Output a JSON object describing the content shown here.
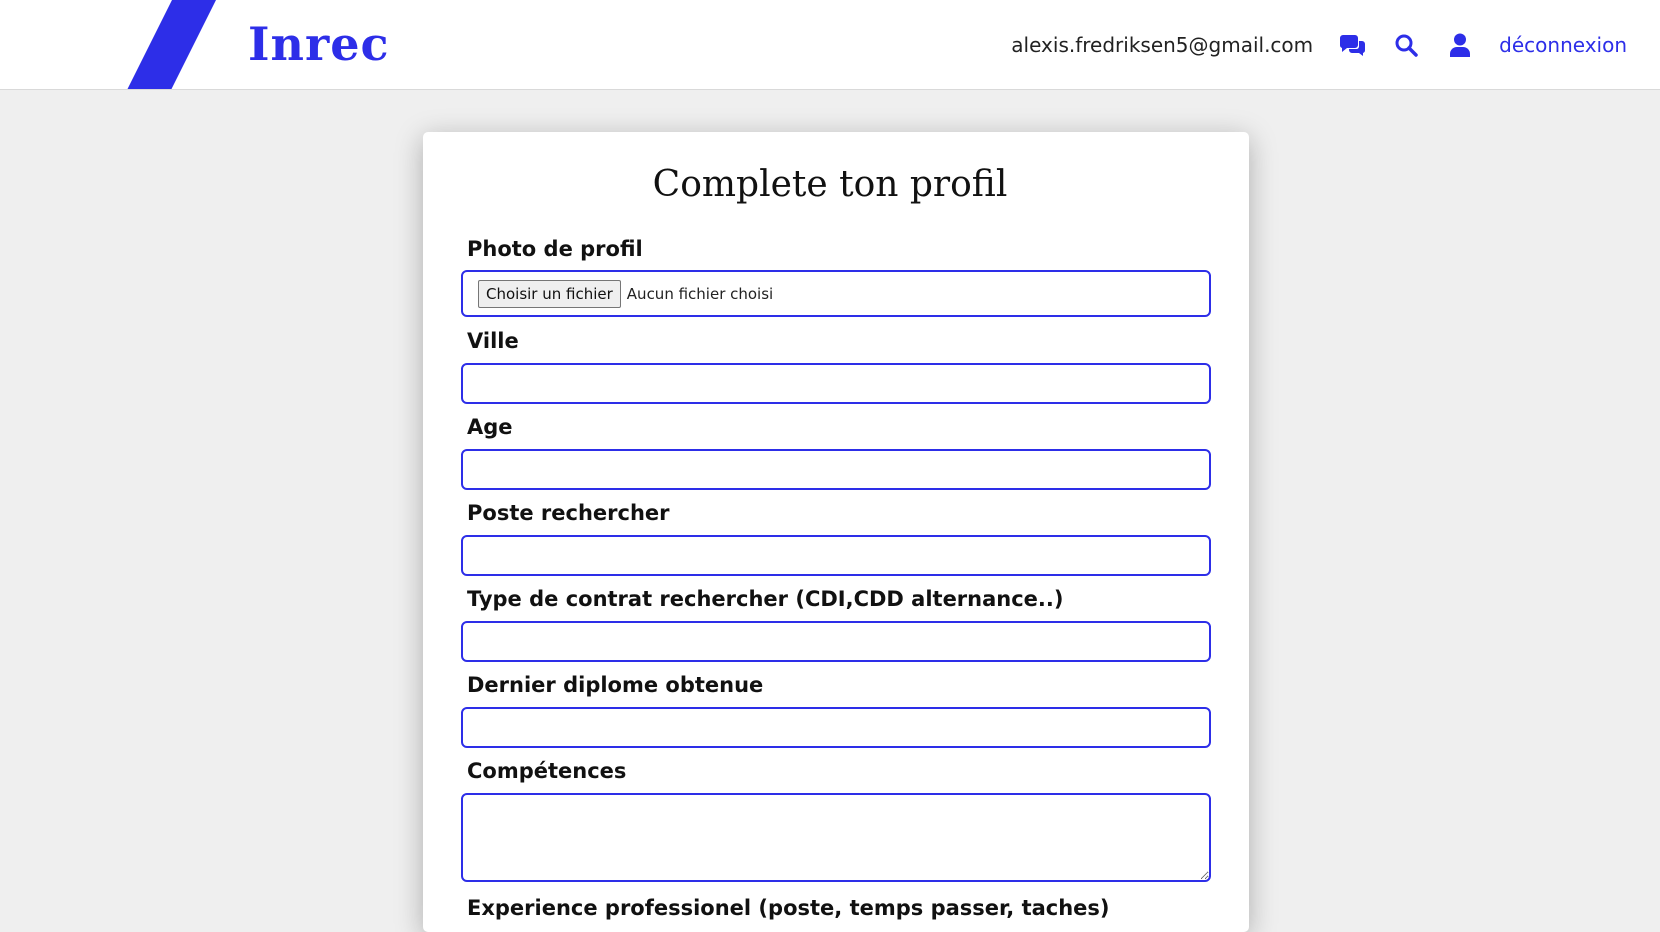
{
  "colors": {
    "accent": "#2d2ee8",
    "background": "#efefef",
    "card": "#ffffff"
  },
  "header": {
    "brand": "Inrec",
    "user_email": "alexis.fredriksen5@gmail.com",
    "icons": [
      "chat-icon",
      "search-icon",
      "user-icon"
    ],
    "logout_label": "déconnexion"
  },
  "form": {
    "title": "Complete ton profil",
    "photo": {
      "label": "Photo de profil",
      "button_label": "Choisir un fichier",
      "status": "Aucun fichier choisi"
    },
    "ville": {
      "label": "Ville",
      "value": ""
    },
    "age": {
      "label": "Age",
      "value": ""
    },
    "poste": {
      "label": "Poste rechercher",
      "value": ""
    },
    "contrat": {
      "label": "Type de contrat rechercher (CDI,CDD alternance..)",
      "value": ""
    },
    "diplome": {
      "label": "Dernier diplome obtenue",
      "value": ""
    },
    "competences": {
      "label": "Compétences",
      "value": ""
    },
    "experience": {
      "label": "Experience professionel (poste, temps passer, taches)"
    }
  }
}
